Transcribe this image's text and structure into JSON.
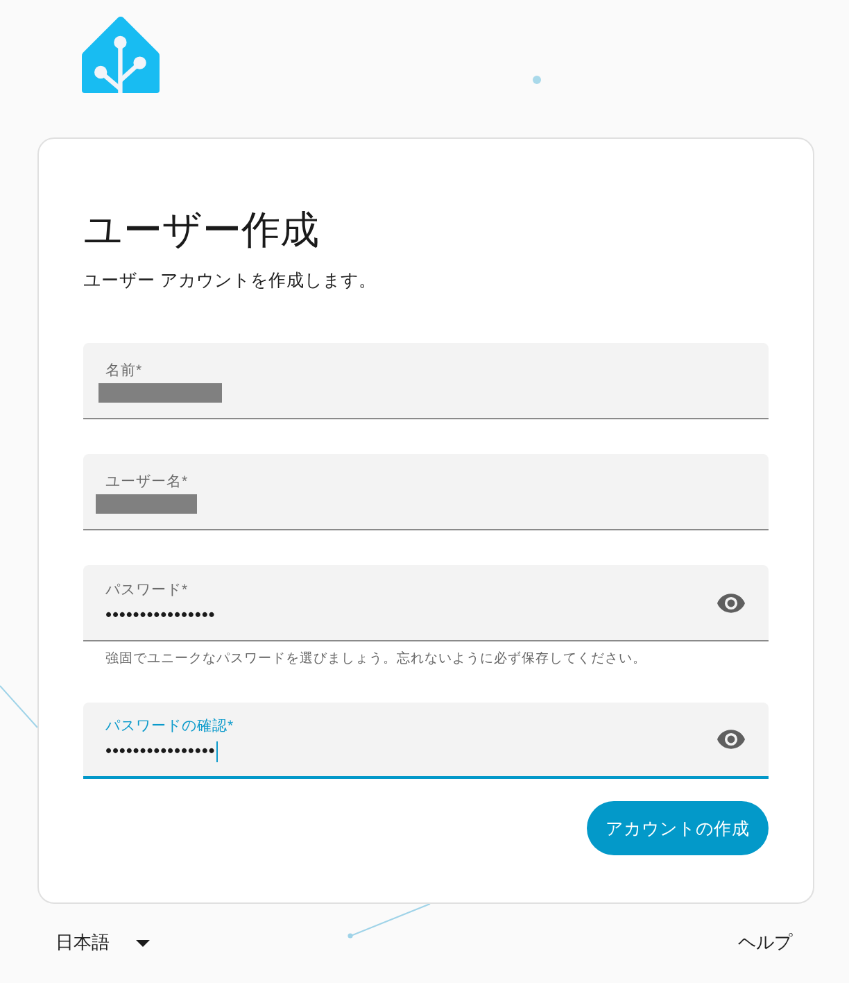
{
  "card": {
    "title": "ユーザー作成",
    "description": "ユーザー アカウントを作成します。"
  },
  "fields": [
    {
      "kind": "text",
      "label": "名前*",
      "redacted": true,
      "focused": false
    },
    {
      "kind": "text",
      "label": "ユーザー名*",
      "redacted": true,
      "focused": false
    },
    {
      "kind": "password",
      "label": "パスワード*",
      "value": "••••••••••••••••",
      "helper": "強固でユニークなパスワードを選びましょう。忘れないように必ず保存してください。",
      "focused": false
    },
    {
      "kind": "password",
      "label": "パスワードの確認*",
      "value": "••••••••••••••••",
      "focused": true
    }
  ],
  "submit_button": "アカウントの作成",
  "footer": {
    "language": "日本語",
    "help": "ヘルプ"
  }
}
